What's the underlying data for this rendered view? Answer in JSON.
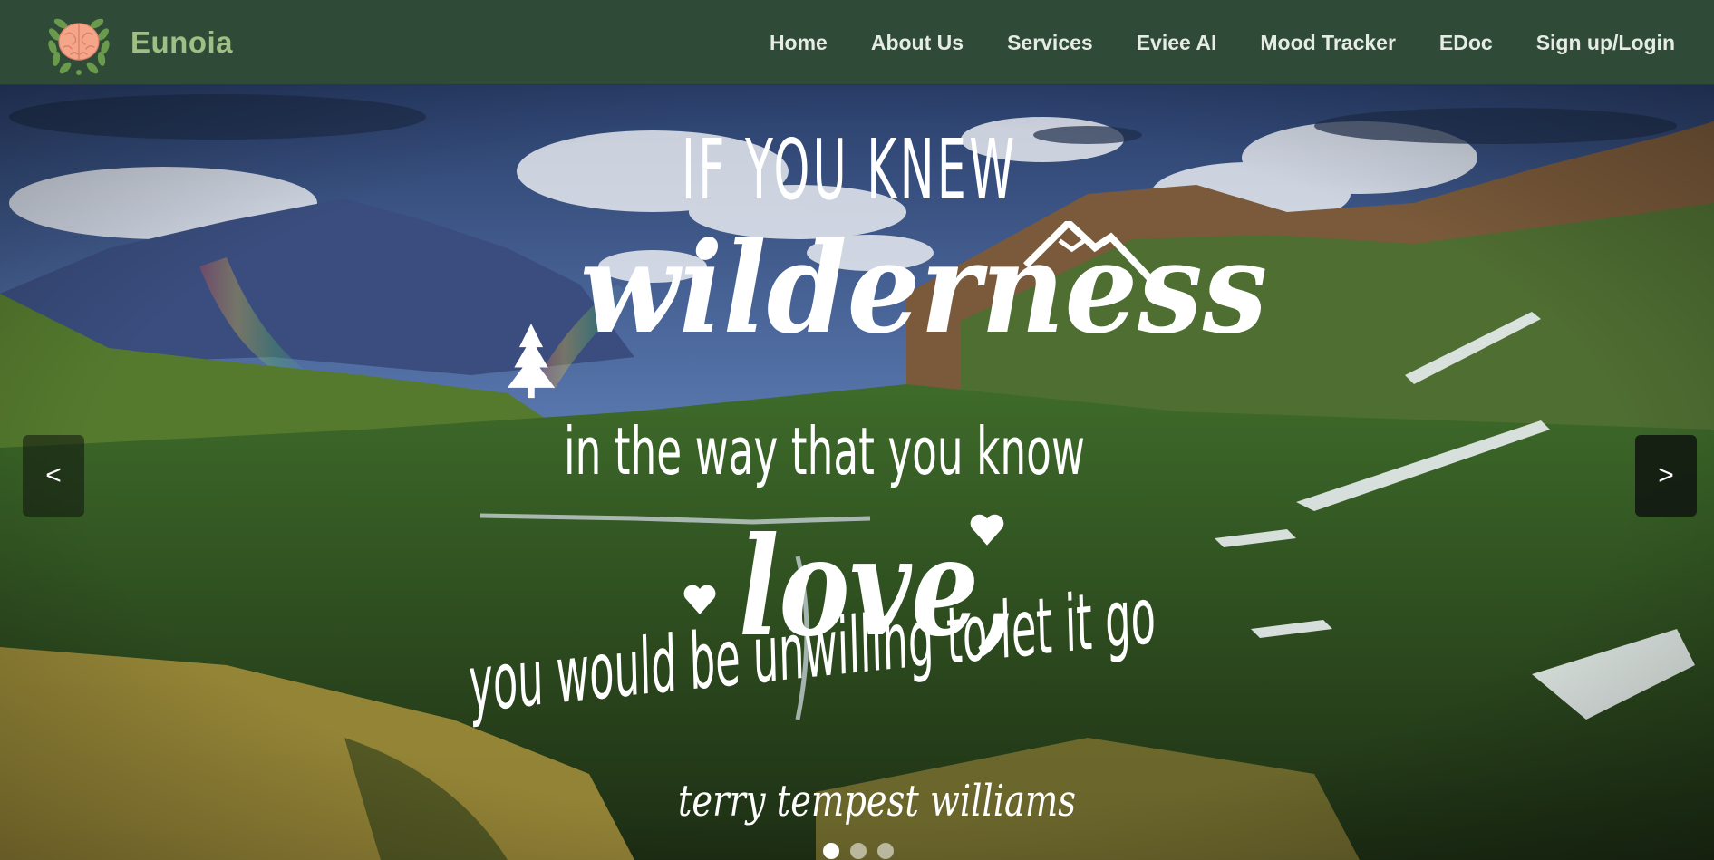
{
  "brand": {
    "name": "Eunoia",
    "logo_icon": "brain-laurel-icon",
    "colors": {
      "nav_bg": "#2f4a36",
      "brand_text": "#9fbf84",
      "logo_brain": "#f4a58a",
      "laurel": "#6a9b4c"
    }
  },
  "nav": {
    "items": [
      {
        "label": "Home"
      },
      {
        "label": "About Us"
      },
      {
        "label": "Services"
      },
      {
        "label": "Eviee AI"
      },
      {
        "label": "Mood Tracker"
      },
      {
        "label": "EDoc"
      },
      {
        "label": "Sign up/Login"
      }
    ]
  },
  "carousel": {
    "slide_quote": {
      "line1": "IF YOU KNEW",
      "line2": "wilderness",
      "line3": "in the way that you know",
      "line4": "love,",
      "line5": "you would be unwilling to let it go",
      "author": "terry tempest williams"
    },
    "prev_label": "<",
    "next_label": ">",
    "slide_count": 3,
    "active_slide": 1
  }
}
